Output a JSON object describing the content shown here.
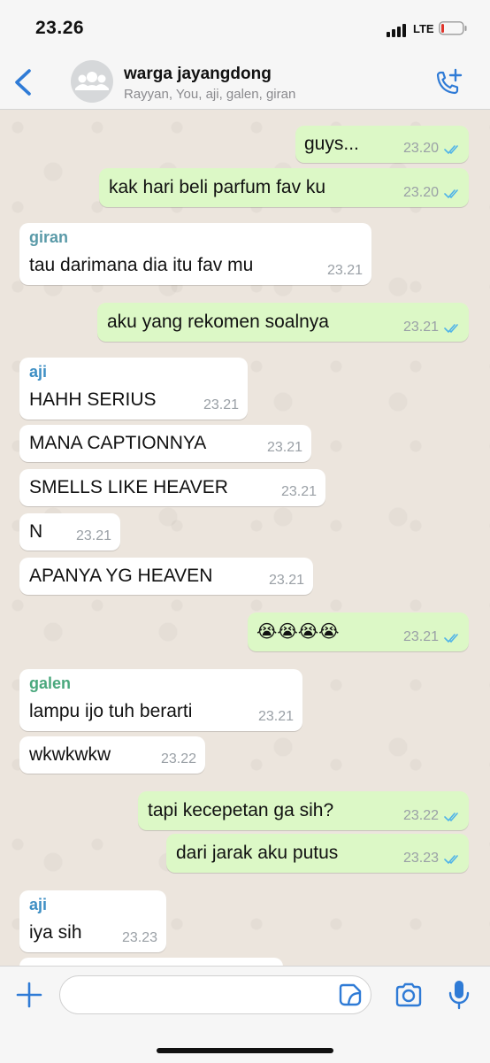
{
  "status_bar": {
    "time": "23.26",
    "network": "LTE",
    "signal_bars": 4,
    "battery_level": 0.08
  },
  "header": {
    "title": "warga jayangdong",
    "subtitle": "Rayyan, You, aji, galen, giran",
    "icons": {
      "back": "chevron-left-icon",
      "avatar": "group-avatar-icon",
      "call": "add-call-icon"
    }
  },
  "colors": {
    "accent": "#2f7bd6",
    "outgoing": "#dcf8c6",
    "incoming": "#ffffff",
    "ticks": "#4fb3e8",
    "sender_giran": "#5a9aa8",
    "sender_aji": "#3e8fc4",
    "sender_galen": "#4aa87d"
  },
  "messages": [
    {
      "dir": "out",
      "text": "guys...",
      "time": "23.20"
    },
    {
      "dir": "out",
      "text": "kak hari beli parfum fav ku",
      "time": "23.20"
    },
    {
      "dir": "in",
      "sender": "giran",
      "text": "tau darimana dia itu fav mu",
      "time": "23.21"
    },
    {
      "dir": "out",
      "text": "aku yang rekomen soalnya",
      "time": "23.21"
    },
    {
      "dir": "in",
      "sender": "aji",
      "text": "HAHH SERIUS",
      "time": "23.21"
    },
    {
      "dir": "in",
      "text": "MANA CAPTIONNYA",
      "time": "23.21"
    },
    {
      "dir": "in",
      "text": "SMELLS LIKE HEAVER",
      "time": "23.21"
    },
    {
      "dir": "in",
      "text": "N",
      "time": "23.21"
    },
    {
      "dir": "in",
      "text": "APANYA YG HEAVEN",
      "time": "23.21"
    },
    {
      "dir": "out",
      "text": "😭😭😭😭",
      "time": "23.21"
    },
    {
      "dir": "in",
      "sender": "galen",
      "text": "lampu ijo tuh berarti",
      "time": "23.21"
    },
    {
      "dir": "in",
      "text": "wkwkwkw",
      "time": "23.22"
    },
    {
      "dir": "out",
      "text": "tapi kecepetan ga sih?",
      "time": "23.22"
    },
    {
      "dir": "out",
      "text": "dari jarak aku putus",
      "time": "23.23"
    },
    {
      "dir": "in",
      "sender": "aji",
      "text": "iya sih",
      "time": "23.23"
    }
  ],
  "input": {
    "placeholder": "",
    "icons": [
      "plus-icon",
      "sticker-icon",
      "camera-icon",
      "mic-icon"
    ]
  }
}
